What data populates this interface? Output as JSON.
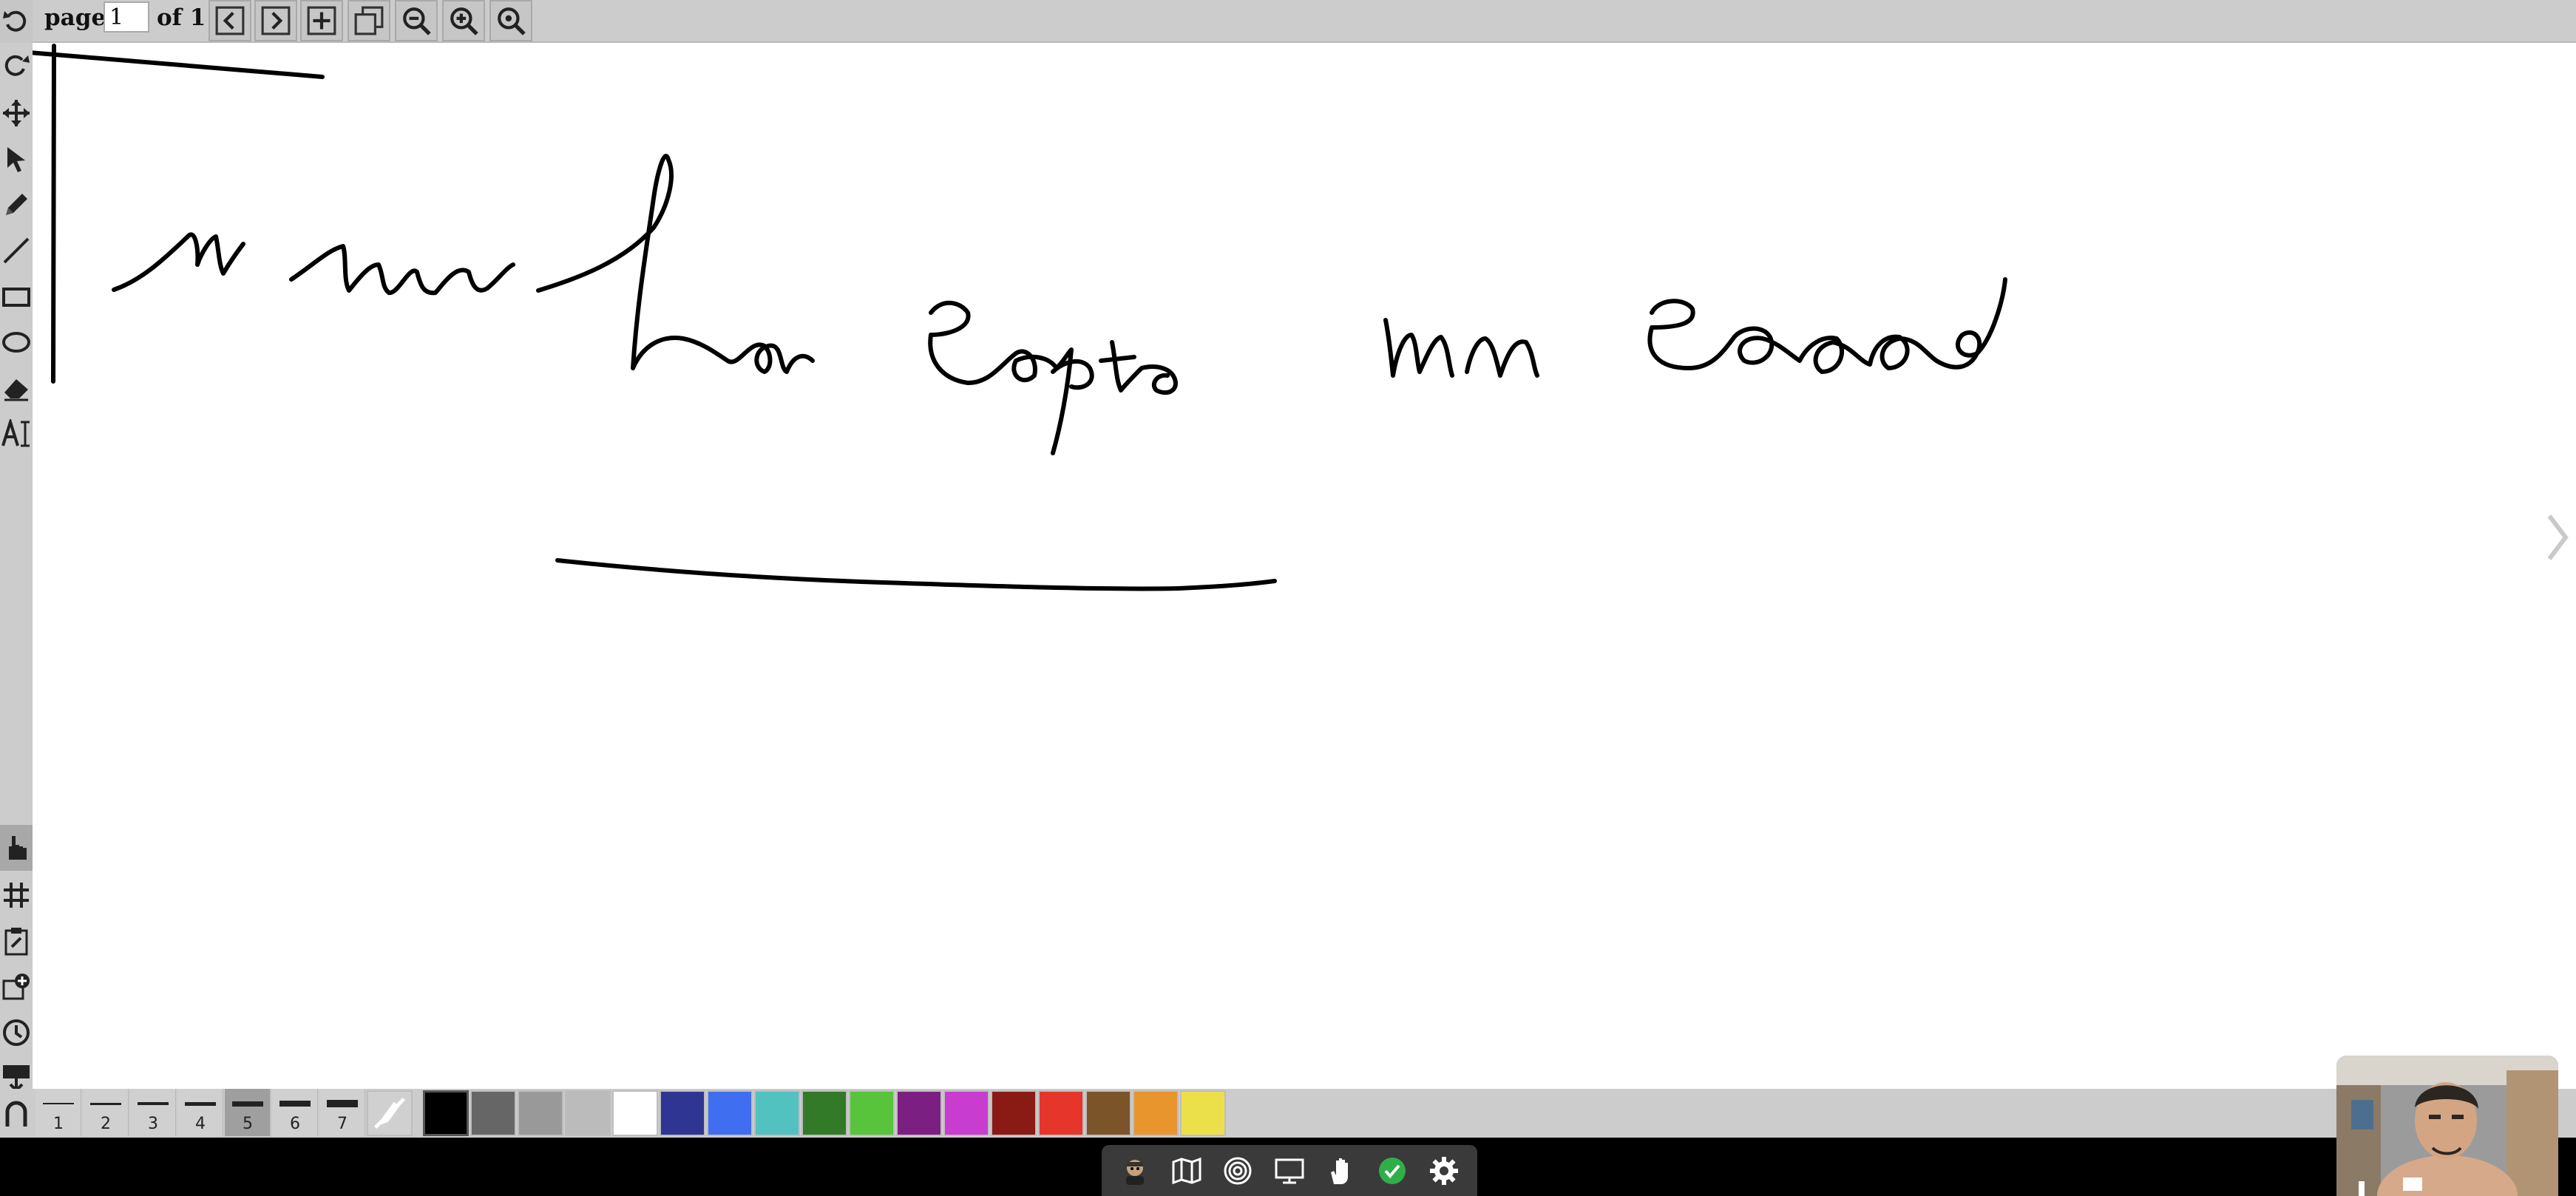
{
  "toolbar": {
    "page_label": "page",
    "page_value": "1",
    "of_label": "of 1",
    "buttons": [
      "prev-page",
      "next-page",
      "add-page",
      "duplicate-page",
      "zoom-out",
      "zoom-in",
      "zoom-fit"
    ]
  },
  "left_tools": [
    "undo",
    "redo",
    "pan",
    "select",
    "pen",
    "line",
    "rectangle",
    "ellipse",
    "eraser",
    "text"
  ],
  "left_tools_bottom": [
    "hand",
    "grid",
    "clipboard",
    "add-image",
    "history",
    "export-svg",
    "link"
  ],
  "thickness": {
    "options": [
      "1",
      "2",
      "3",
      "4",
      "5",
      "6",
      "7"
    ],
    "selected": "5"
  },
  "palette": {
    "colors": [
      "#000000",
      "#666666",
      "#999999",
      "#bbbbbb",
      "#ffffff",
      "#2e3592",
      "#3f6ff0",
      "#52c2c0",
      "#327a28",
      "#58c43c",
      "#7c1f82",
      "#c83cd0",
      "#8a1a14",
      "#e6352b",
      "#7b5429",
      "#e8952e",
      "#ece04a"
    ],
    "selected": "#000000"
  },
  "bottom_actions": [
    "user-avatar",
    "map",
    "target",
    "screen-share",
    "raise-hand",
    "status-ok",
    "settings"
  ],
  "accent": {
    "ok_green": "#2fae4a"
  }
}
